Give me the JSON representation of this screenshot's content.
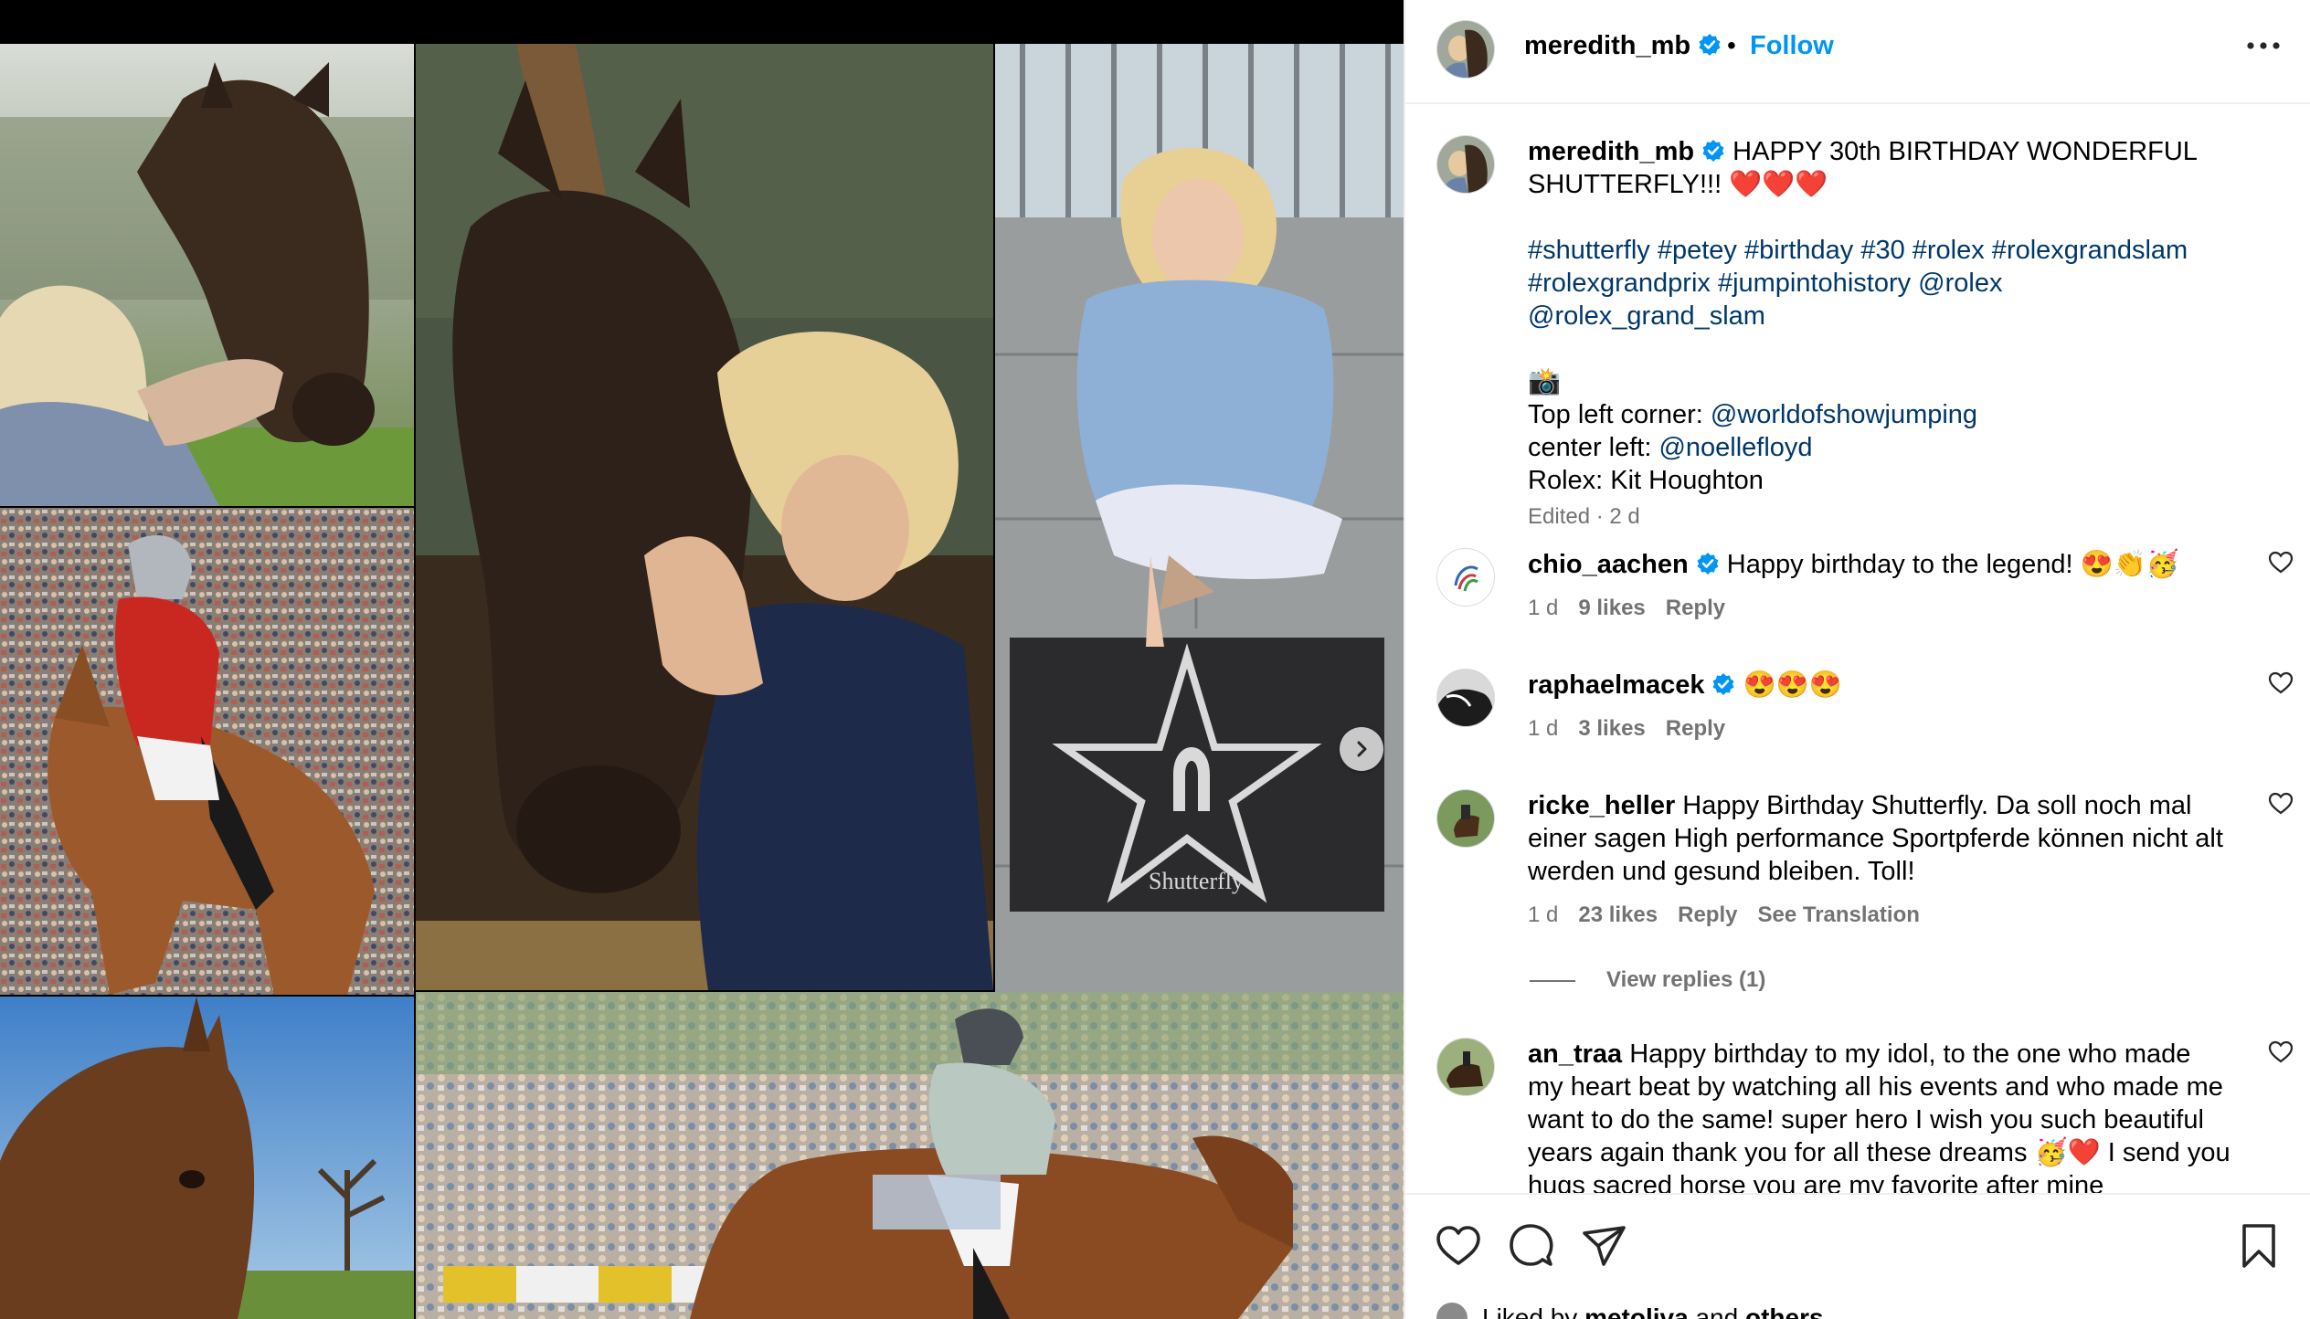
{
  "post": {
    "author": "meredith_mb",
    "follow_label": "Follow",
    "separator": "•",
    "caption_line1": " HAPPY 30th BIRTHDAY WONDERFUL SHUTTERFLY!!! ",
    "caption_hearts": "❤️❤️❤️",
    "hashtags_line1": "#shutterfly #petey #birthday #30 #rolex #rolexgrandslam",
    "hashtags_line2": "#rolexgrandprix #jumpintohistory @rolex @rolex_grand_slam",
    "camera_emoji": "📸",
    "credit1_label": "Top left corner: ",
    "credit1_handle": "@worldofshowjumping",
    "credit2_label": "center left: ",
    "credit2_handle": "@noellefloyd",
    "credit3": "Rolex: Kit Houghton",
    "edited": "Edited · 2 d",
    "star_plaque_text": "Shutterfly"
  },
  "comments": [
    {
      "user": "chio_aachen",
      "verified": true,
      "text": " Happy birthday to the legend! ",
      "emojis": "😍👏🥳",
      "time": "1 d",
      "likes": "9 likes",
      "reply": "Reply"
    },
    {
      "user": "raphaelmacek",
      "verified": true,
      "text": " ",
      "emojis": "😍😍😍",
      "time": "1 d",
      "likes": "3 likes",
      "reply": "Reply"
    },
    {
      "user": "ricke_heller",
      "verified": false,
      "text": " Happy Birthday Shutterfly. Da soll noch mal einer sagen High performance Sportpferde können nicht alt werden und gesund bleiben. Toll!",
      "time": "1 d",
      "likes": "23 likes",
      "reply": "Reply",
      "translate": "See Translation"
    },
    {
      "user": "an_traa",
      "verified": false,
      "text": " Happy birthday to my idol, to the one who made my heart beat by watching all his events and who made me want to do the same! super hero I wish you such beautiful years again thank you for all these dreams ",
      "emojis": "🥳❤️",
      "text_after": " I send you hugs sacred horse you are my favorite after mine"
    }
  ],
  "view_replies": "View replies (1)",
  "liked_by": {
    "prefix": "Liked by ",
    "user": "metoliva",
    "middle": " and ",
    "others": "others"
  },
  "icons": [
    "verified-badge-icon",
    "more-options-icon",
    "heart-icon",
    "comment-icon",
    "share-icon",
    "bookmark-icon",
    "next-arrow-icon"
  ],
  "colors": {
    "link": "#00376b",
    "follow": "#0095f6",
    "verified": "#0095f6",
    "muted": "#737373"
  }
}
